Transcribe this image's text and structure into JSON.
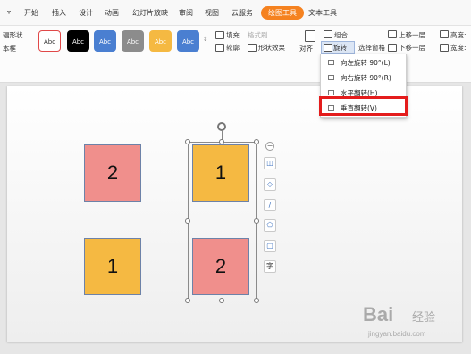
{
  "tabs": [
    "开始",
    "插入",
    "设计",
    "动画",
    "幻灯片放映",
    "审阅",
    "视图",
    "云服务",
    "绘图工具",
    "文本工具"
  ],
  "left_labels": {
    "line1": "辐形状",
    "line2": "本框"
  },
  "style_swatches": [
    {
      "label": "Abc",
      "bg": "#ffffff",
      "fg": "#333333",
      "border": "#e04848"
    },
    {
      "label": "Abc",
      "bg": "#000000",
      "fg": "#ffffff",
      "border": "#000000"
    },
    {
      "label": "Abc",
      "bg": "#4a7fd1",
      "fg": "#ffffff",
      "border": "#4a7fd1"
    },
    {
      "label": "Abc",
      "bg": "#8c8c8c",
      "fg": "#ffffff",
      "border": "#8c8c8c"
    },
    {
      "label": "Abc",
      "bg": "#f5b942",
      "fg": "#ffffff",
      "border": "#f5b942"
    },
    {
      "label": "Abc",
      "bg": "#4a7fd1",
      "fg": "#ffffff",
      "border": "#4a7fd1"
    }
  ],
  "ribbon": {
    "fill": "填充",
    "outline": "轮廓",
    "textfmt": "格式刷",
    "shape_effect": "形状效果",
    "combine": "组合",
    "align": "对齐",
    "rotate": "旋转",
    "select_pane": "选择窗格",
    "bring_forward": "上移一层",
    "send_backward": "下移一层",
    "height": "高度:",
    "width": "宽度:"
  },
  "rotate_menu": [
    {
      "label": "向左旋转 90°(L)"
    },
    {
      "label": "向右旋转 90°(R)"
    },
    {
      "label": "水平翻转(H)"
    },
    {
      "label": "垂直翻转(V)"
    }
  ],
  "shapes": {
    "a": "2",
    "b": "1",
    "c": "1",
    "d": "2"
  },
  "float_buttons": {
    "text": "字"
  },
  "watermark": {
    "main": "Bai",
    "cn": "经验",
    "url": "jingyan.baidu.com"
  },
  "colors": {
    "accent": "#f58220",
    "highlight": "#e41c1c",
    "pink": "#f08f8c",
    "orange": "#f5b942"
  }
}
